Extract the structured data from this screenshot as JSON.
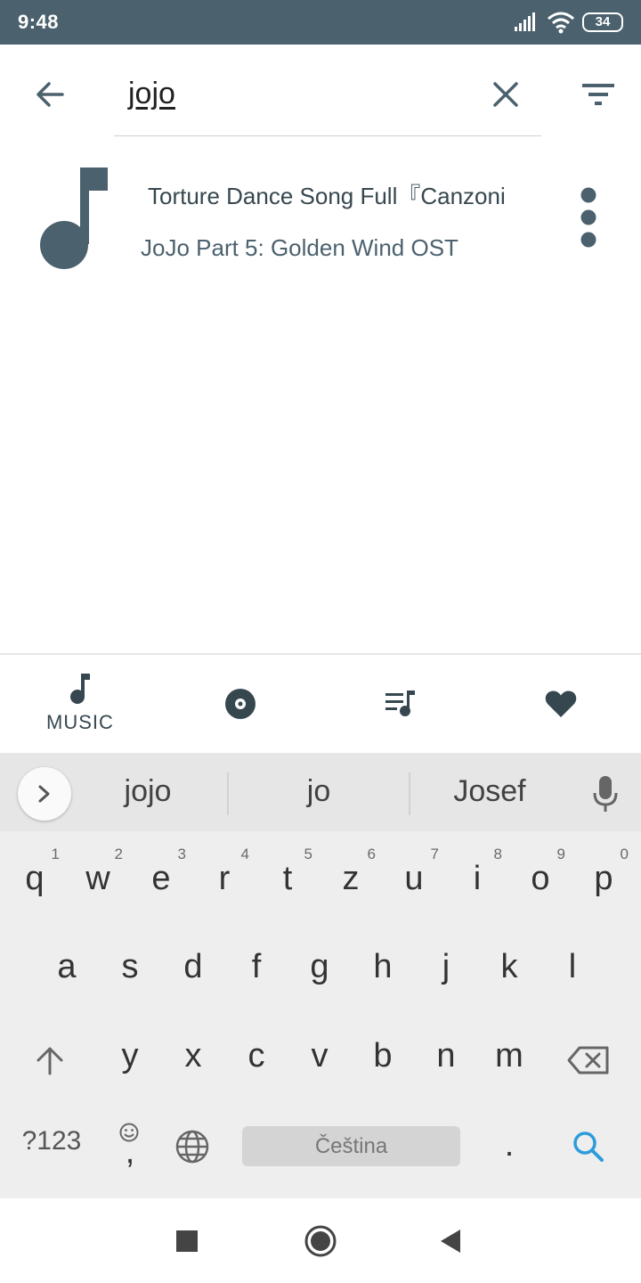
{
  "status_bar": {
    "time": "9:48",
    "battery_level": "34"
  },
  "search": {
    "query": "jojo"
  },
  "results": [
    {
      "title": "Torture Dance Song Full『Canzoni",
      "subtitle": "JoJo Part 5: Golden Wind OST"
    }
  ],
  "bottom_nav": {
    "music_label": "MUSIC"
  },
  "keyboard": {
    "suggestions": [
      "jojo",
      "jo",
      "Josef"
    ],
    "row1": [
      {
        "key": "q",
        "hint": "1"
      },
      {
        "key": "w",
        "hint": "2"
      },
      {
        "key": "e",
        "hint": "3"
      },
      {
        "key": "r",
        "hint": "4"
      },
      {
        "key": "t",
        "hint": "5"
      },
      {
        "key": "z",
        "hint": "6"
      },
      {
        "key": "u",
        "hint": "7"
      },
      {
        "key": "i",
        "hint": "8"
      },
      {
        "key": "o",
        "hint": "9"
      },
      {
        "key": "p",
        "hint": "0"
      }
    ],
    "row2": [
      "a",
      "s",
      "d",
      "f",
      "g",
      "h",
      "j",
      "k",
      "l"
    ],
    "row3": [
      "y",
      "x",
      "c",
      "v",
      "b",
      "n",
      "m"
    ],
    "symbols_label": "?123",
    "comma_label": ",",
    "space_label": "Čeština",
    "period_label": "."
  },
  "colors": {
    "accent": "#4b626e",
    "search_key": "#2d9cdb"
  }
}
